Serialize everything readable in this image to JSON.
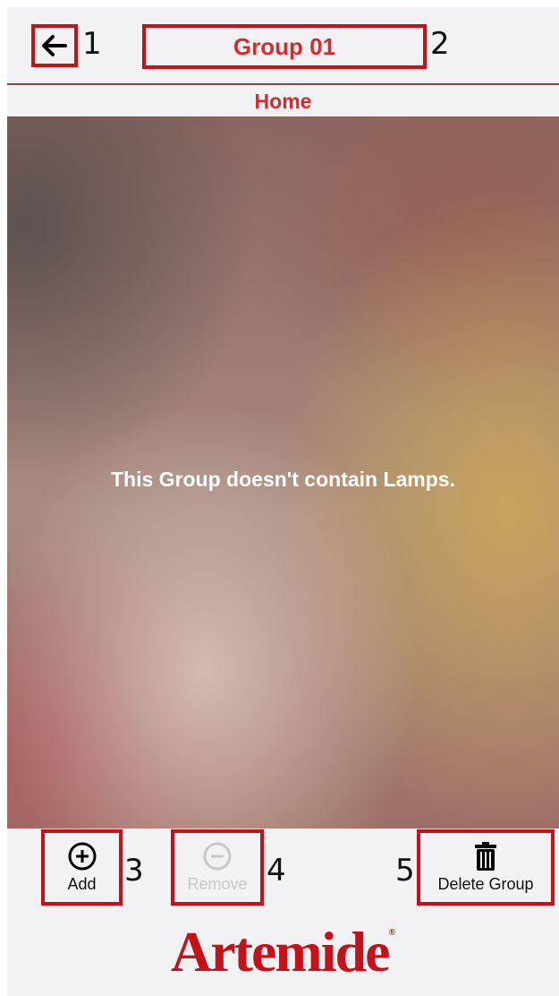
{
  "header": {
    "title": "Group 01",
    "back_icon": "arrow-left-icon"
  },
  "callouts": [
    "1",
    "2",
    "3",
    "4",
    "5"
  ],
  "subtitle": "Home",
  "content": {
    "empty_message": "This Group doesn't contain Lamps."
  },
  "toolbar": {
    "add_label": "Add",
    "remove_label": "Remove",
    "delete_label": "Delete Group",
    "add_icon": "plus-circle-icon",
    "remove_icon": "minus-circle-icon",
    "delete_icon": "trash-icon",
    "remove_disabled": true
  },
  "footer": {
    "logo_text": "Artemide",
    "logo_reg": "®"
  },
  "colors": {
    "accent": "#d62b2b",
    "highlight_border": "#c4121b",
    "background": "#f2f2f4",
    "disabled": "#c9c9c9"
  }
}
